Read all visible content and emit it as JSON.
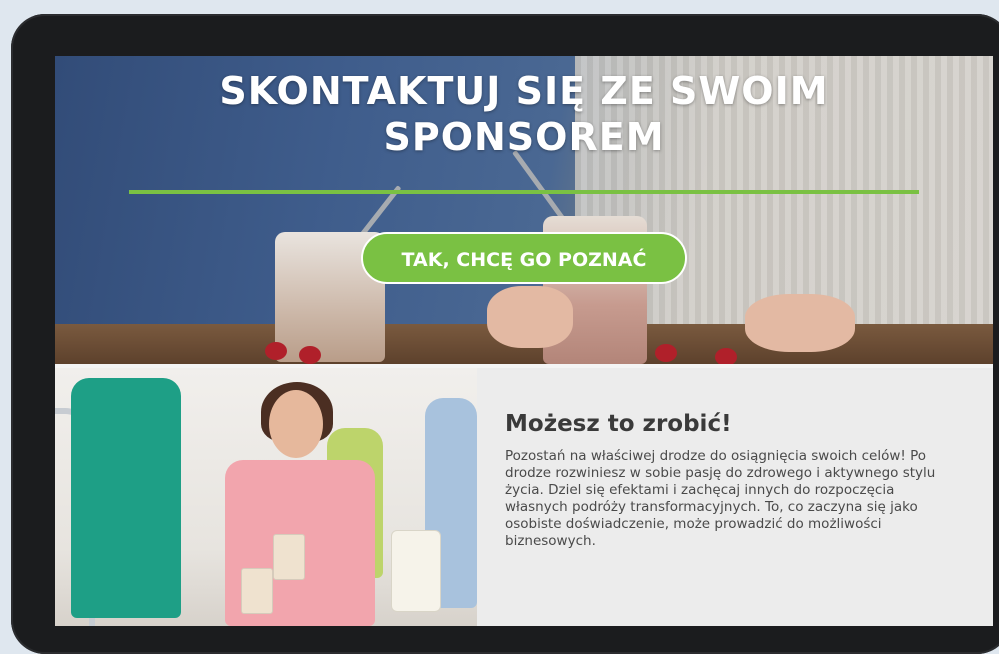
{
  "hero": {
    "title_line1": "SKONTAKTUJ SIĘ ZE SWOIM",
    "title_line2": "SPONSOREM",
    "cta_label": "TAK, CHCĘ GO POZNAĆ",
    "accent_color": "#7ac143"
  },
  "info": {
    "heading": "Możesz to zrobić!",
    "body": "Pozostań na właściwej drodze do osiągnięcia swoich celów! Po drodze rozwiniesz w sobie pasję do zdrowego i aktywnego stylu życia. Dziel się efektami i zachęcaj innych do rozpoczęcia własnych podróży transformacyjnych. To, co zaczyna się jako osobiste doświadczenie, może prowadzić do możliwości biznesowych."
  }
}
